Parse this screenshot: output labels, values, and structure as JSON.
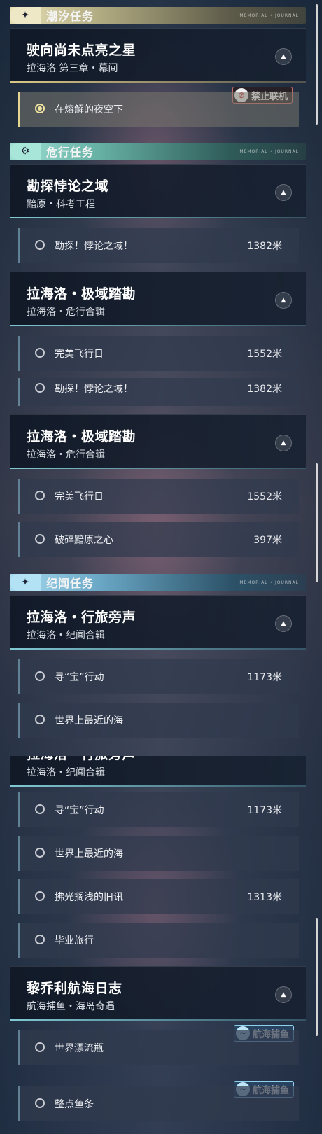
{
  "panel1": {
    "cat_tide": {
      "icon": "sparkle-icon",
      "title": "潮汐任务"
    },
    "card_star": {
      "name": "驶向尚未点亮之星",
      "sub": "拉海洛 第三章・幕间"
    },
    "flag_offline": {
      "icon": "no-coop-icon",
      "label": "禁止联机"
    },
    "item_night": {
      "label": "在熔解的夜空下"
    },
    "cat_danger": {
      "icon": "compass-icon",
      "title": "危行任务"
    },
    "card_paradox": {
      "name": "勘探悖论之域",
      "sub": "黯原・科考工程"
    },
    "item_explore": {
      "label": "勘探！悖论之域！",
      "dist": "1382米"
    },
    "card_polar": {
      "name": "拉海洛・极域踏勘",
      "sub": "拉海洛・危行合辑"
    },
    "item_flight": {
      "label": "完美飞行日",
      "dist": "1552米"
    }
  },
  "panel2": {
    "item_explore": {
      "label": "勘探！悖论之域！",
      "dist": "1382米"
    },
    "card_polar": {
      "name": "拉海洛・极域踏勘",
      "sub": "拉海洛・危行合辑"
    },
    "item_flight": {
      "label": "完美飞行日",
      "dist": "1552米"
    },
    "item_heart": {
      "label": "破碎黯原之心",
      "dist": "397米"
    },
    "cat_story": {
      "icon": "sparkle-icon",
      "title": "纪闻任务"
    },
    "card_travel": {
      "name": "拉海洛・行旅旁声",
      "sub": "拉海洛・纪闻合辑"
    },
    "item_treasure": {
      "label": "寻“宝”行动",
      "dist": "1173米"
    },
    "item_sea": {
      "label": "世界上最近的海"
    }
  },
  "panel3": {
    "cut_title": "拉海洛・行旅旁声",
    "card_travel_sub": "拉海洛・纪闻合辑",
    "item_treasure": {
      "label": "寻“宝”行动",
      "dist": "1173米"
    },
    "item_sea": {
      "label": "世界上最近的海"
    },
    "item_news": {
      "label": "拂光搁浅的旧讯",
      "dist": "1313米"
    },
    "item_grad": {
      "label": "毕业旅行"
    },
    "card_log": {
      "name": "黎乔利航海日志",
      "sub": "航海捕鱼・海岛奇遇"
    },
    "flag_fish1": {
      "icon": "fishing-icon",
      "label": "航海捕鱼"
    },
    "item_bottle": {
      "label": "世界漂流瓶"
    },
    "flag_fish2": {
      "icon": "fishing-icon",
      "label": "航海捕鱼"
    },
    "item_fish": {
      "label": "整点鱼条"
    }
  },
  "tag_text": "MEMORIAL • JOURNAL",
  "colors": {
    "tide": "#e9e1b6",
    "danger": "#9fe0d4",
    "story": "#a8dcf0",
    "offline": "#c96b6b"
  }
}
